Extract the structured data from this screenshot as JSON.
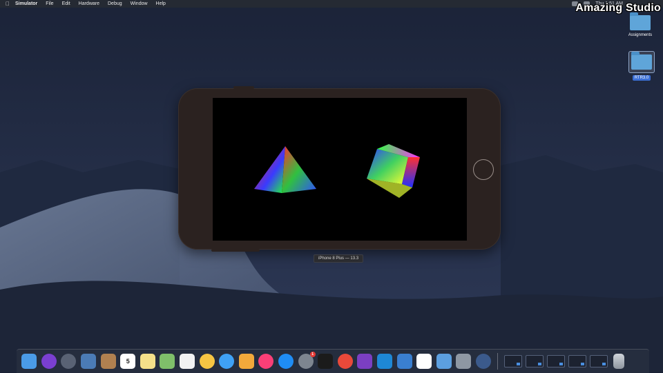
{
  "menubar": {
    "apple_icon": "apple-icon",
    "items": [
      "Simulator",
      "File",
      "Edit",
      "Hardware",
      "Debug",
      "Window",
      "Help"
    ],
    "clock": "Thu 1:51 AM"
  },
  "watermark": "Amazing Studio",
  "desktop_icons": [
    {
      "label": "Assignments",
      "icon": "folder-icon"
    },
    {
      "label": "RTR3.0",
      "icon": "folder-icon"
    }
  ],
  "simulator": {
    "device_label": "iPhone 8 Plus — 13.3",
    "scene": {
      "shapes": [
        "pyramid",
        "cube"
      ]
    }
  },
  "dock": {
    "apps": [
      {
        "name": "finder-icon",
        "color": "#4a9be8"
      },
      {
        "name": "siri-icon",
        "color": "#7a3fd0"
      },
      {
        "name": "launchpad-icon",
        "color": "#596274"
      },
      {
        "name": "preview-icon",
        "color": "#4b7bb6"
      },
      {
        "name": "contacts-icon",
        "color": "#b08050"
      },
      {
        "name": "calendar-icon",
        "color": "#ffffff",
        "text": "5"
      },
      {
        "name": "notes-icon",
        "color": "#f4e08a"
      },
      {
        "name": "maps-icon",
        "color": "#7fbf6a"
      },
      {
        "name": "reminders-icon",
        "color": "#f2f2f2"
      },
      {
        "name": "photos-icon",
        "color": "#f6c543"
      },
      {
        "name": "messages-icon",
        "color": "#3fa1f5"
      },
      {
        "name": "pages-icon",
        "color": "#f2a93b"
      },
      {
        "name": "itunes-icon",
        "color": "#fa3f77"
      },
      {
        "name": "app-store-icon",
        "color": "#1f8df5"
      },
      {
        "name": "system-preferences-icon",
        "color": "#7d8590",
        "badge": "1"
      },
      {
        "name": "terminal-icon",
        "color": "#1b1b1b"
      },
      {
        "name": "chrome-icon",
        "color": "#e9493a"
      },
      {
        "name": "visual-studio-icon",
        "color": "#7b3fc2"
      },
      {
        "name": "vscode-icon",
        "color": "#1e88d6"
      },
      {
        "name": "xcode-icon",
        "color": "#3a7fd0"
      },
      {
        "name": "instruments-icon",
        "color": "#ffffff"
      },
      {
        "name": "simulator-app-icon",
        "color": "#5c9fe0"
      },
      {
        "name": "disk-utility-icon",
        "color": "#8e97a3"
      },
      {
        "name": "quicktime-icon",
        "color": "#3b5a8c"
      }
    ],
    "windows": [
      "window-thumb-1",
      "window-thumb-2",
      "window-thumb-3",
      "window-thumb-4",
      "window-thumb-5"
    ],
    "trash": "trash-icon"
  }
}
